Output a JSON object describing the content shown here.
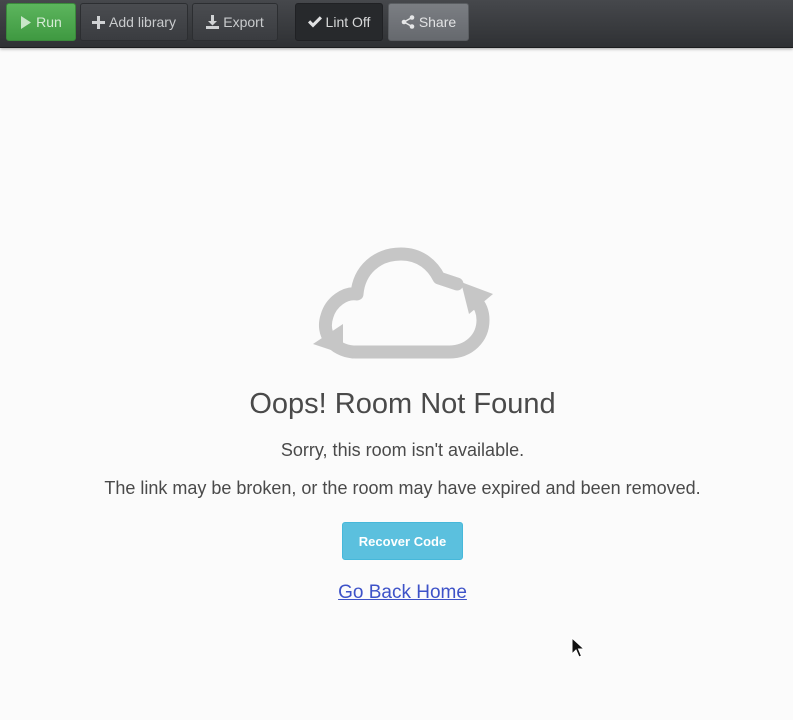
{
  "toolbar": {
    "run_label": "Run",
    "add_library_label": "Add library",
    "export_label": "Export",
    "lint_label": "Lint Off",
    "share_label": "Share"
  },
  "error": {
    "title": "Oops! Room Not Found",
    "message": "Sorry, this room isn't available.",
    "detail": "The link may be broken, or the room may have expired and been removed.",
    "recover_label": "Recover Code",
    "home_link": "Go Back Home"
  },
  "colors": {
    "run_green": "#4cae4c",
    "info_button": "#5bc0de",
    "link_blue": "#3d52c8",
    "cloud_gray": "#c6c6c6"
  },
  "icons": {
    "run": "play-icon",
    "add_library": "plus-icon",
    "export": "download-icon",
    "lint": "check-icon",
    "share": "share-icon",
    "illustration": "cloud-sync-icon"
  }
}
